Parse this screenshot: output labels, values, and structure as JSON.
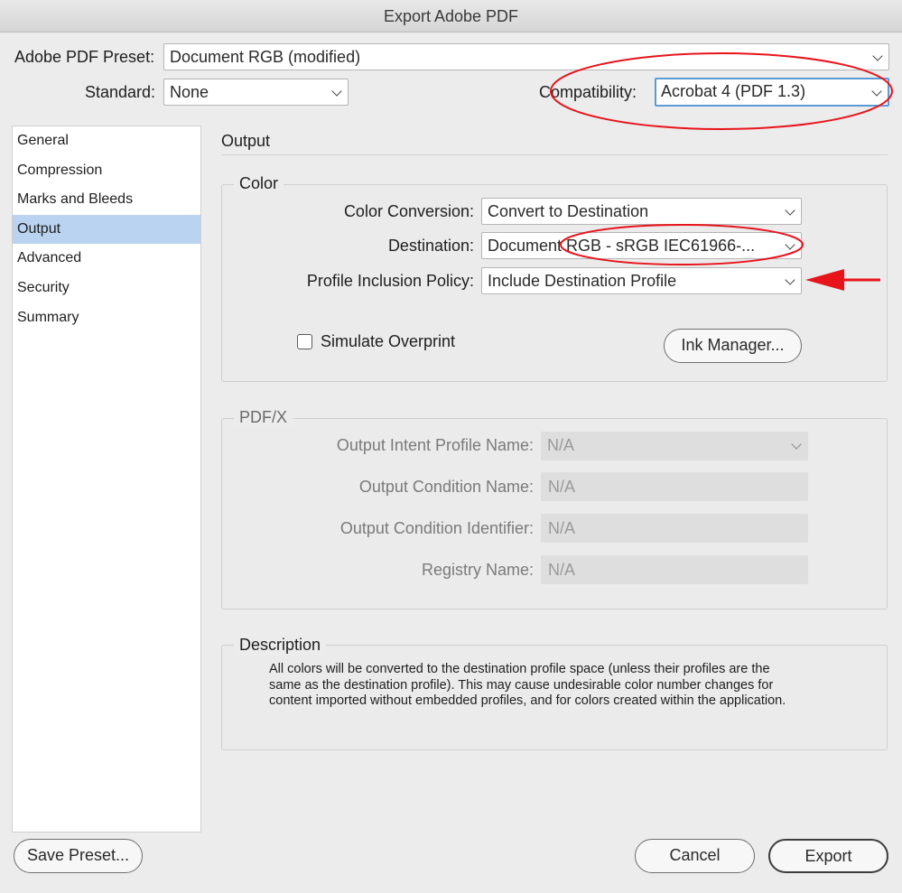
{
  "window": {
    "title": "Export Adobe PDF"
  },
  "preset": {
    "label": "Adobe PDF Preset:",
    "value": "Document RGB (modified)"
  },
  "standard": {
    "label": "Standard:",
    "value": "None"
  },
  "compatibility": {
    "label": "Compatibility:",
    "value": "Acrobat 4 (PDF 1.3)"
  },
  "sidebar": {
    "items": [
      {
        "label": "General"
      },
      {
        "label": "Compression"
      },
      {
        "label": "Marks and Bleeds"
      },
      {
        "label": "Output"
      },
      {
        "label": "Advanced"
      },
      {
        "label": "Security"
      },
      {
        "label": "Summary"
      }
    ]
  },
  "main": {
    "heading": "Output",
    "color": {
      "title": "Color",
      "conversion": {
        "label": "Color Conversion:",
        "value": "Convert to Destination"
      },
      "destination": {
        "label": "Destination:",
        "value": "Document RGB - sRGB IEC61966-..."
      },
      "profile": {
        "label": "Profile Inclusion Policy:",
        "value": "Include Destination Profile"
      },
      "simulate": {
        "label": "Simulate Overprint",
        "checked": false
      },
      "ink_manager": "Ink Manager..."
    },
    "pdfx": {
      "title": "PDF/X",
      "intent": {
        "label": "Output Intent Profile Name:",
        "value": "N/A"
      },
      "condition_name": {
        "label": "Output Condition Name:",
        "value": "N/A"
      },
      "condition_id": {
        "label": "Output Condition Identifier:",
        "value": "N/A"
      },
      "registry": {
        "label": "Registry Name:",
        "value": "N/A"
      }
    },
    "description": {
      "title": "Description",
      "lines": [
        "All colors will be converted to the destination profile space (unless their profiles are the",
        "same as the destination profile). This may cause undesirable color number changes for",
        "content imported without embedded profiles, and for colors created within the application."
      ]
    }
  },
  "footer": {
    "save_preset": "Save Preset...",
    "cancel": "Cancel",
    "export": "Export"
  },
  "colors": {
    "annotation": "#e8141c",
    "selection": "#b9d3f0"
  }
}
